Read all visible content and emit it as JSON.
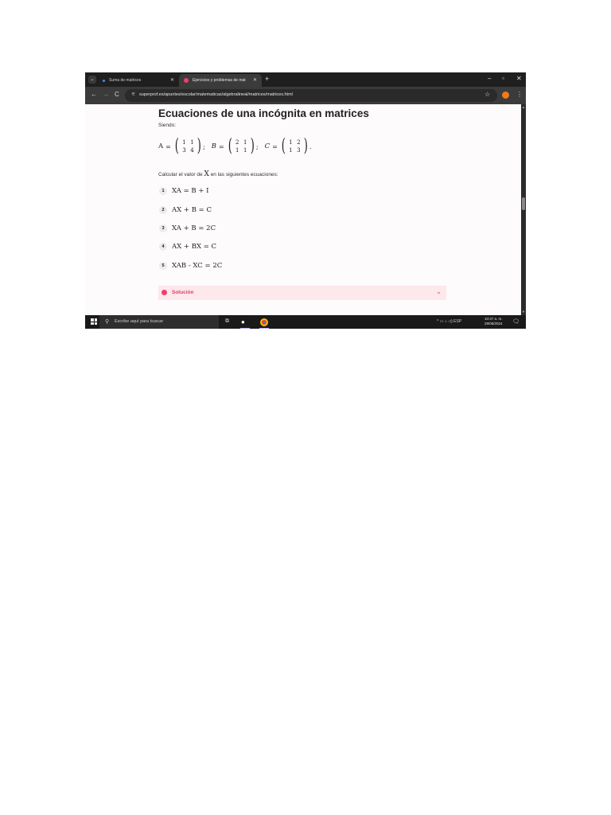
{
  "browser": {
    "tabs": [
      {
        "label": "Suma de matrices",
        "active": false
      },
      {
        "label": "Ejercicios y problemas de mat",
        "active": true
      }
    ],
    "tab_list_icon": "chevron-down-icon",
    "new_tab_icon": "+",
    "window_controls": {
      "minimize": "–",
      "maximize": "▫",
      "close": "✕"
    },
    "nav": {
      "back": "←",
      "forward": "→",
      "reload": "C"
    },
    "url": "superprof.es/apuntes/escolar/matematicas/algebralineal/matrices/matrices.html",
    "bookmark_icon": "☆",
    "menu_icon": "⋮"
  },
  "page": {
    "title": "Ecuaciones de una incógnita en matrices",
    "siendo": "Siendo:",
    "matrices": [
      {
        "name": "A",
        "italic": false,
        "rows": [
          [
            "1",
            "1"
          ],
          [
            "3",
            "4"
          ]
        ],
        "sep": ";"
      },
      {
        "name": "B",
        "italic": true,
        "rows": [
          [
            "2",
            "1"
          ],
          [
            "1",
            "1"
          ]
        ],
        "sep": ";"
      },
      {
        "name": "C",
        "italic": true,
        "rows": [
          [
            "1",
            "2"
          ],
          [
            "1",
            "3"
          ]
        ],
        "sep": "."
      }
    ],
    "calc_prefix": "Calcular el valor de",
    "calc_var": "X",
    "calc_suffix": "en las siguientes ecuaciones:",
    "equations": [
      {
        "n": "1",
        "expr": "XA = B + I"
      },
      {
        "n": "2",
        "expr": "AX + B = C"
      },
      {
        "n": "3",
        "expr": "XA + B = 2C"
      },
      {
        "n": "4",
        "expr": "AX + BX = C"
      },
      {
        "n": "5",
        "expr": "XAB - XC = 2C"
      }
    ],
    "solution_label": "Solución",
    "solution_chevron": "⌄"
  },
  "taskbar": {
    "search_placeholder": "Escribe aquí para buscar",
    "tray": "^  ▭  ⌂  ◁)  ESP",
    "time": "10:37 a. m.",
    "date": "29/08/2024"
  },
  "colors": {
    "accent": "#ef3e6a",
    "solution_bg": "#fde8ec",
    "chrome_dark": "#1f1f1f"
  }
}
